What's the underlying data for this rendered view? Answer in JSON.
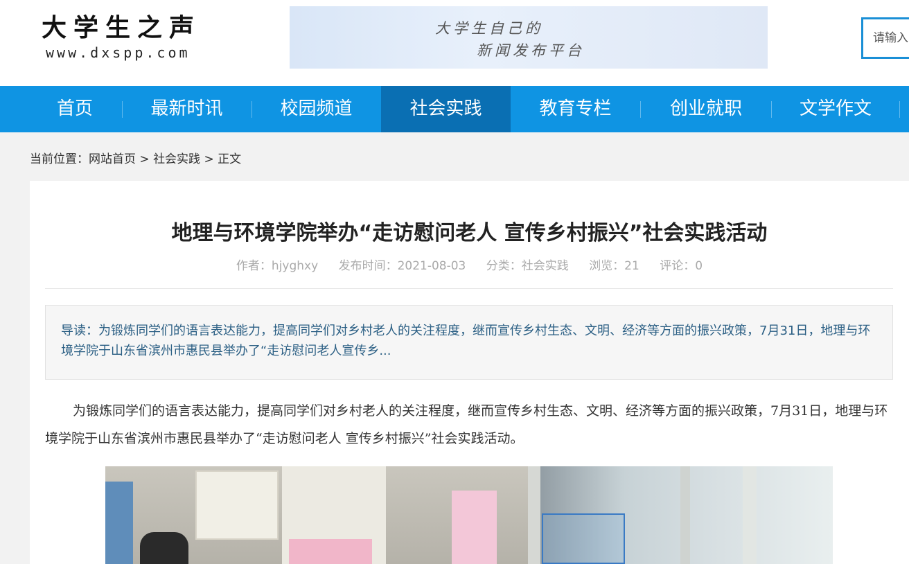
{
  "header": {
    "logo_title": "大学生之声",
    "logo_url": "www.dxspp.com",
    "banner_line1": "大学生自己的",
    "banner_line2": "新闻发布平台",
    "search_placeholder": "请输入"
  },
  "nav": {
    "items": [
      {
        "label": "首页"
      },
      {
        "label": "最新时讯"
      },
      {
        "label": "校园频道"
      },
      {
        "label": "社会实践"
      },
      {
        "label": "教育专栏"
      },
      {
        "label": "创业就职"
      },
      {
        "label": "文学作文"
      }
    ],
    "active_index": 3
  },
  "breadcrumb": {
    "prefix": "当前位置：",
    "home": "网站首页",
    "sep1": " > ",
    "category": "社会实践",
    "sep2": " > ",
    "current": "正文"
  },
  "article": {
    "title": "地理与环境学院举办“走访慰问老人 宣传乡村振兴”社会实践活动",
    "meta": {
      "author": "作者：hjyghxy",
      "date": "发布时间：2021-08-03",
      "category": "分类：社会实践",
      "views": "浏览：21",
      "comments": "评论：0"
    },
    "summary": "导读：为锻炼同学们的语言表达能力，提高同学们对乡村老人的关注程度，继而宣传乡村生态、文明、经济等方面的振兴政策，7月31日，地理与环境学院于山东省滨州市惠民县举办了“走访慰问老人宣传乡...",
    "body": "为锻炼同学们的语言表达能力，提高同学们对乡村老人的关注程度，继而宣传乡村生态、文明、经济等方面的振兴政策，7月31日，地理与环境学院于山东省滨州市惠民县举办了“走访慰问老人  宣传乡村振兴”社会实践活动。"
  },
  "colors": {
    "nav_bg": "#0f94e3",
    "nav_active": "#0a6fb3",
    "search_border": "#1a8fd6",
    "summary_text": "#2b5f84"
  }
}
